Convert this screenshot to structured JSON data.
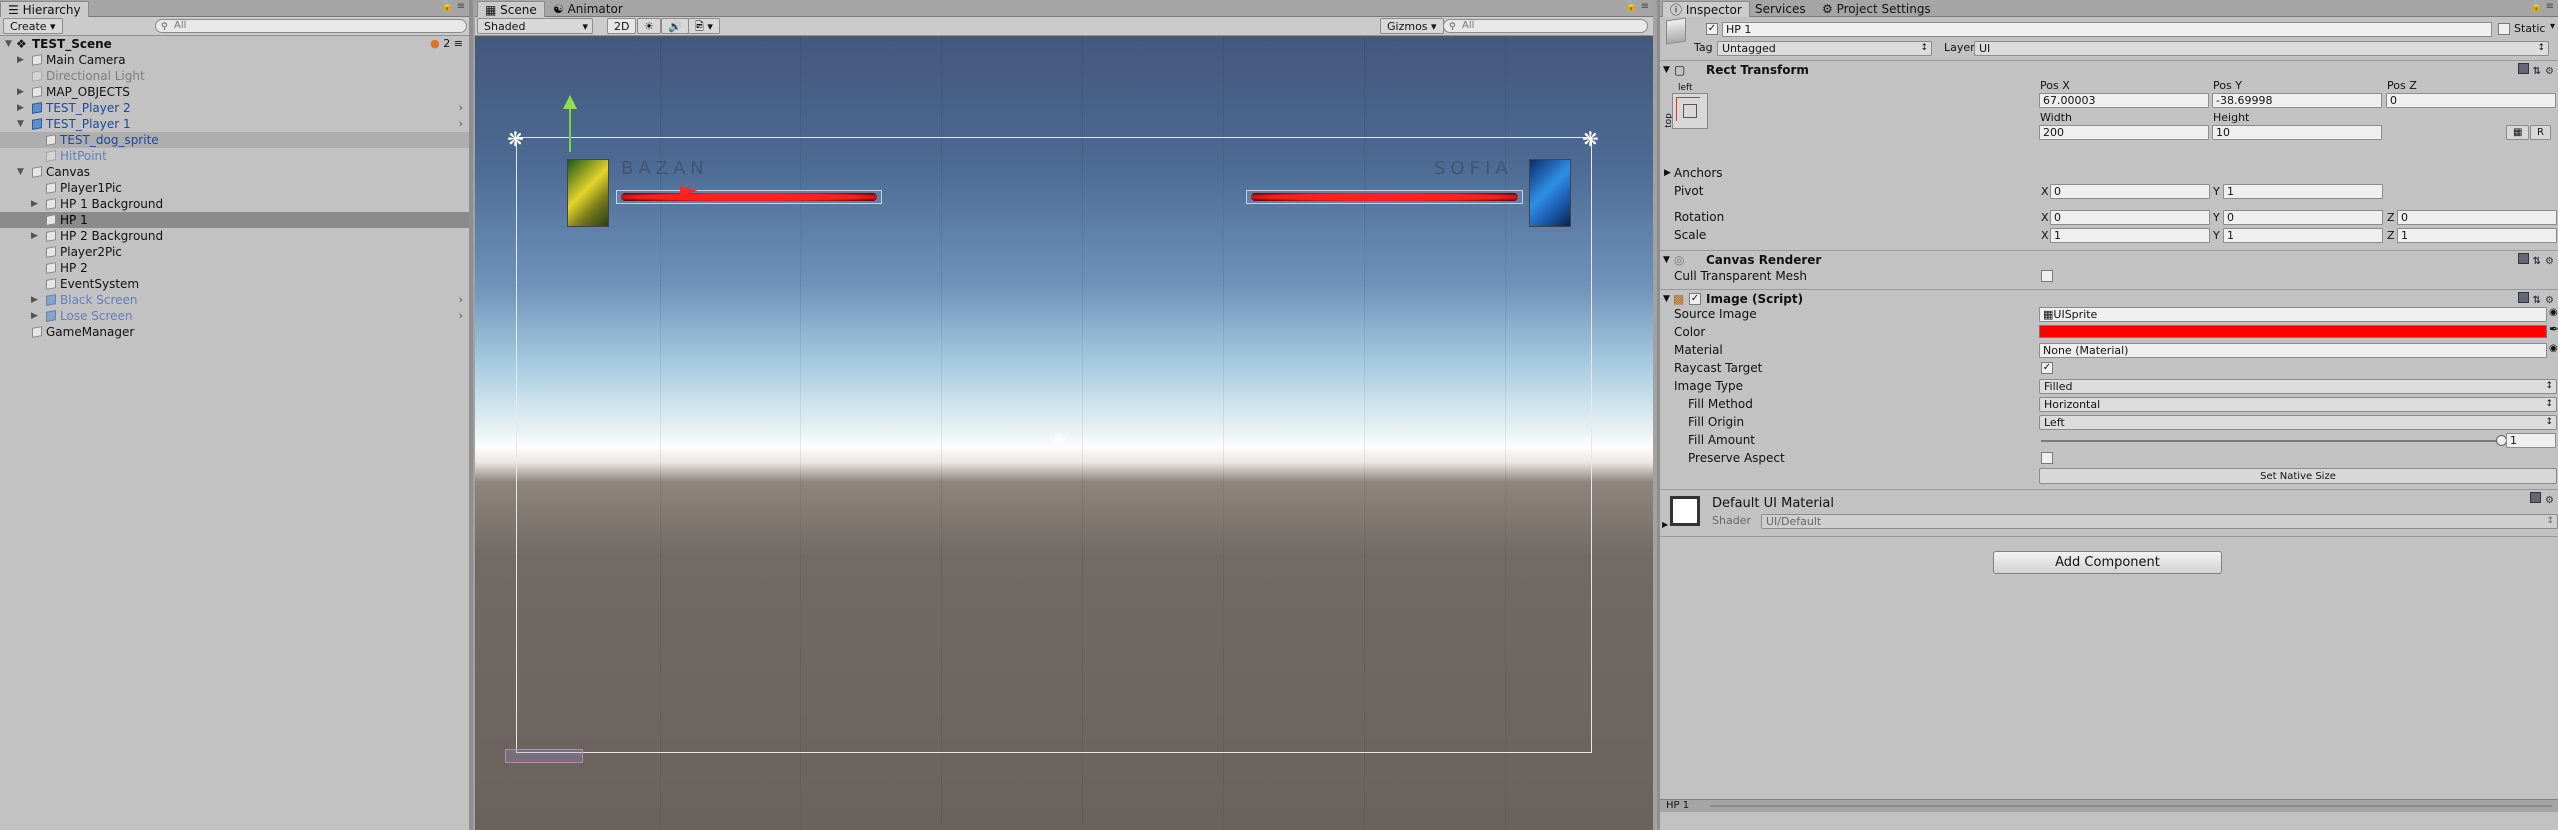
{
  "hierarchy": {
    "tab": "Hierarchy",
    "create": "Create",
    "search_placeholder": "All",
    "scene_name": "TEST_Scene",
    "scene_count": "2",
    "items": [
      {
        "label": "Main Camera"
      },
      {
        "label": "Directional Light"
      },
      {
        "label": "MAP_OBJECTS"
      },
      {
        "label": "TEST_Player 2"
      },
      {
        "label": "TEST_Player 1"
      },
      {
        "label": "TEST_dog_sprite"
      },
      {
        "label": "HitPoint"
      },
      {
        "label": "Canvas"
      },
      {
        "label": "Player1Pic"
      },
      {
        "label": "HP 1 Background"
      },
      {
        "label": "HP 1"
      },
      {
        "label": "HP 2 Background"
      },
      {
        "label": "Player2Pic"
      },
      {
        "label": "HP 2"
      },
      {
        "label": "EventSystem"
      },
      {
        "label": "Black Screen"
      },
      {
        "label": "Lose Screen"
      },
      {
        "label": "GameManager"
      }
    ]
  },
  "scene": {
    "tabs": [
      "Scene",
      "Animator"
    ],
    "shading": "Shaded",
    "mode_2d": "2D",
    "gizmos": "Gizmos",
    "search_placeholder": "All",
    "player1_name": "BAZAN",
    "player2_name": "SOFIA"
  },
  "inspector": {
    "tabs": [
      "Inspector",
      "Services",
      "Project Settings"
    ],
    "object_name": "HP 1",
    "static_label": "Static",
    "tag_label": "Tag",
    "tag_value": "Untagged",
    "layer_label": "Layer",
    "layer_value": "UI",
    "rect_transform": {
      "title": "Rect Transform",
      "anchor_h": "left",
      "anchor_v": "top",
      "posx_label": "Pos X",
      "posx": "67.00003",
      "posy_label": "Pos Y",
      "posy": "-38.69998",
      "posz_label": "Pos Z",
      "posz": "0",
      "width_label": "Width",
      "width": "200",
      "height_label": "Height",
      "height": "10",
      "anchors": "Anchors",
      "pivot": "Pivot",
      "pivot_x": "0",
      "pivot_y": "1",
      "rotation": "Rotation",
      "rot_x": "0",
      "rot_y": "0",
      "rot_z": "0",
      "scale": "Scale",
      "scale_x": "1",
      "scale_y": "1",
      "scale_z": "1",
      "r_button": "R"
    },
    "canvas_renderer": {
      "title": "Canvas Renderer",
      "cull_label": "Cull Transparent Mesh"
    },
    "image": {
      "title": "Image (Script)",
      "source_image_label": "Source Image",
      "source_image": "UISprite",
      "color_label": "Color",
      "color": "#ff0000",
      "material_label": "Material",
      "material": "None (Material)",
      "raycast_label": "Raycast Target",
      "image_type_label": "Image Type",
      "image_type": "Filled",
      "fill_method_label": "Fill Method",
      "fill_method": "Horizontal",
      "fill_origin_label": "Fill Origin",
      "fill_origin": "Left",
      "fill_amount_label": "Fill Amount",
      "fill_amount": "1",
      "preserve_label": "Preserve Aspect",
      "native_size": "Set Native Size"
    },
    "material": {
      "name": "Default UI Material",
      "shader_label": "Shader",
      "shader": "UI/Default"
    },
    "add_component": "Add Component",
    "footer": "HP 1"
  }
}
